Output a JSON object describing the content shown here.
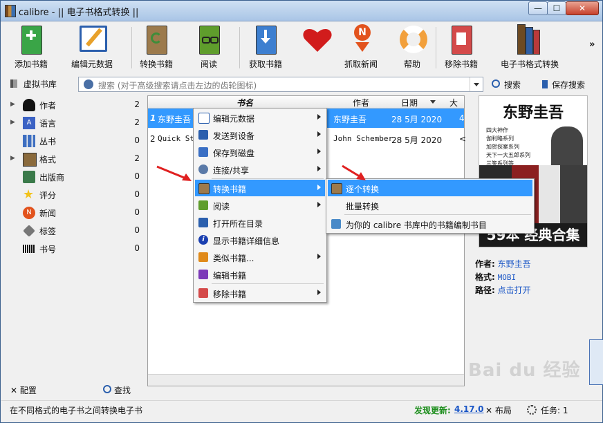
{
  "window": {
    "title": "calibre - || 电子书格式转换 ||",
    "minimize": "—",
    "maximize": "☐",
    "close": "✕"
  },
  "toolbar": {
    "add": "添加书籍",
    "edit_meta": "编辑元数据",
    "convert": "转换书籍",
    "read": "阅读",
    "fetch": "获取书籍",
    "love": "",
    "news": "抓取新闻",
    "help": "帮助",
    "remove": "移除书籍",
    "ebook_convert": "电子书格式转换",
    "more": "»"
  },
  "searchbar": {
    "virtual_library": "虚拟书库",
    "placeholder": "搜索 (对于高级搜索请点击左边的齿轮图标)",
    "search_button": "搜索",
    "save_search": "保存搜索"
  },
  "categories": [
    {
      "label": "作者",
      "count": "2",
      "expandable": true
    },
    {
      "label": "语言",
      "count": "2",
      "expandable": true
    },
    {
      "label": "丛书",
      "count": "0",
      "expandable": false
    },
    {
      "label": "格式",
      "count": "2",
      "expandable": true
    },
    {
      "label": "出版商",
      "count": "0",
      "expandable": false
    },
    {
      "label": "评分",
      "count": "0",
      "expandable": false
    },
    {
      "label": "新闻",
      "count": "0",
      "expandable": false
    },
    {
      "label": "标签",
      "count": "0",
      "expandable": false
    },
    {
      "label": "书号",
      "count": "0",
      "expandable": false
    }
  ],
  "leftpane_bottom": {
    "configure": "配置",
    "find": "查找"
  },
  "booklist": {
    "columns": [
      "书名",
      "作者",
      "日期",
      "大小"
    ],
    "rows": [
      {
        "num": "1",
        "title": "东野圭吾",
        "author": "东野圭吾",
        "date": "28 5月 2020",
        "size": "4"
      },
      {
        "num": "2",
        "title": "Quick Sta",
        "author": "John Schember",
        "date": "28 5月 2020",
        "size": "<"
      }
    ]
  },
  "cover": {
    "title": "东野圭吾",
    "lines": [
      "四大神作",
      "伽利略系列",
      "加贺探案系列",
      "天下一大五郎系列",
      "三笑系列等"
    ],
    "band": "59本 经典合集"
  },
  "details": {
    "author_label": "作者:",
    "author": "东野圭吾",
    "format_label": "格式:",
    "format": "MOBI",
    "path_label": "路径:",
    "path": "点击打开"
  },
  "context_menu": [
    {
      "label": "编辑元数据",
      "submenu": true
    },
    {
      "label": "发送到设备",
      "submenu": true
    },
    {
      "label": "保存到磁盘",
      "submenu": true
    },
    {
      "label": "连接/共享",
      "submenu": true
    },
    {
      "label": "转换书籍",
      "submenu": true,
      "highlighted": true
    },
    {
      "label": "阅读",
      "submenu": true
    },
    {
      "label": "打开所在目录",
      "submenu": false
    },
    {
      "label": "显示书籍详细信息",
      "submenu": false
    },
    {
      "label": "类似书籍...",
      "submenu": true
    },
    {
      "label": "编辑书籍",
      "submenu": false
    },
    {
      "label": "移除书籍",
      "submenu": true
    }
  ],
  "submenu": [
    {
      "label": "逐个转换",
      "highlighted": true
    },
    {
      "label": "批量转换",
      "highlighted": false
    },
    {
      "label": "为你的 calibre 书库中的书籍编制书目",
      "highlighted": false
    }
  ],
  "status": {
    "message": "在不同格式的电子书之间转换电子书",
    "update_label": "发现更新:",
    "version": "4.17.0",
    "layout": "布局",
    "jobs": "任务: 1"
  },
  "watermark": "Bai du 经验",
  "colors": {
    "selection": "#3399ff",
    "link": "#1a56c6",
    "update": "#1f8f1f",
    "arrow": "#e02020"
  }
}
